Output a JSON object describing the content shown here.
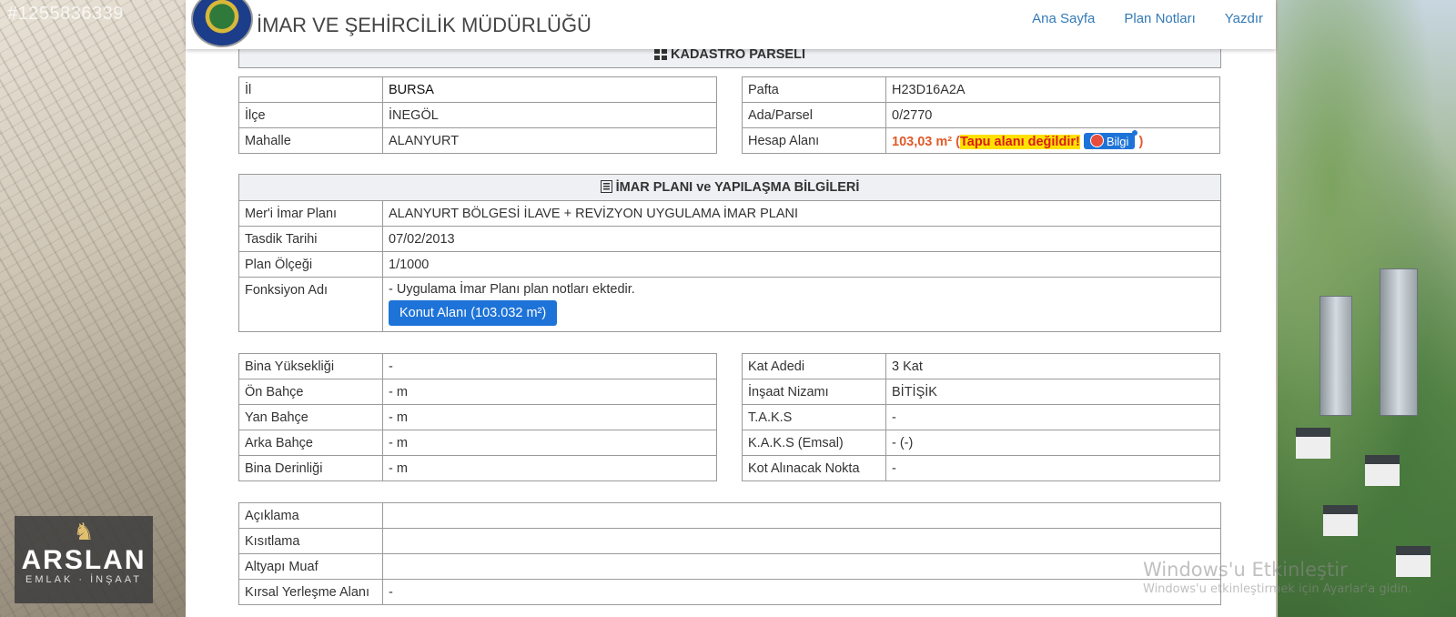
{
  "watermark_id": "#1255836339",
  "agency": {
    "line1": "ARSLAN",
    "line2": "EMLAK · İNŞAAT"
  },
  "header": {
    "title": "İMAR VE ŞEHİRCİLİK MÜDÜRLÜĞÜ",
    "nav": [
      "Ana Sayfa",
      "Plan Notları",
      "Yazdır"
    ]
  },
  "kadastro": {
    "title": "KADASTRO PARSELİ",
    "left": [
      {
        "label": "İl",
        "value": "BURSA"
      },
      {
        "label": "İlçe",
        "value": "İNEGÖL"
      },
      {
        "label": "Mahalle",
        "value": "ALANYURT"
      }
    ],
    "right": [
      {
        "label": "Pafta",
        "value": "H23D16A2A"
      },
      {
        "label": "Ada/Parsel",
        "value": "0/2770"
      },
      {
        "label": "Hesap Alanı",
        "value": "103,03 m²",
        "open": " (",
        "warning": "Tapu alanı değildir!",
        "button": "Bilgi",
        "close": " )"
      }
    ]
  },
  "imar": {
    "title": "İMAR PLANI ve YAPILAŞMA BİLGİLERİ",
    "rows": [
      {
        "label": "Mer'i İmar Planı",
        "value": "ALANYURT BÖLGESİ İLAVE + REVİZYON UYGULAMA İMAR PLANI"
      },
      {
        "label": "Tasdik Tarihi",
        "value": "07/02/2013"
      },
      {
        "label": "Plan Ölçeği",
        "value": "1/1000"
      }
    ],
    "fonksiyon": {
      "label": "Fonksiyon Adı",
      "note": "- Uygulama İmar Planı plan notları ektedir.",
      "button": "Konut Alanı (103.032 m²)"
    }
  },
  "yapi": {
    "left": [
      {
        "label": "Bina Yüksekliği",
        "value": "-"
      },
      {
        "label": "Ön Bahçe",
        "value": "- m"
      },
      {
        "label": "Yan Bahçe",
        "value": "- m"
      },
      {
        "label": "Arka Bahçe",
        "value": "- m"
      },
      {
        "label": "Bina Derinliği",
        "value": "- m"
      }
    ],
    "right": [
      {
        "label": "Kat Adedi",
        "value": "3 Kat"
      },
      {
        "label": "İnşaat Nizamı",
        "value": "BİTİŞİK"
      },
      {
        "label": "T.A.K.S",
        "value": "-"
      },
      {
        "label": "K.A.K.S (Emsal)",
        "value": "- (-)"
      },
      {
        "label": "Kot Alınacak Nokta",
        "value": "-"
      }
    ]
  },
  "notes": [
    {
      "label": "Açıklama",
      "value": ""
    },
    {
      "label": "Kısıtlama",
      "value": ""
    },
    {
      "label": "Altyapı Muaf",
      "value": ""
    },
    {
      "label": "Kırsal Yerleşme Alanı",
      "value": "-"
    }
  ],
  "windows_watermark": {
    "line1": "Windows'u Etkinleştir",
    "line2": "Windows'u etkinleştirmek için Ayarlar'a gidin."
  }
}
